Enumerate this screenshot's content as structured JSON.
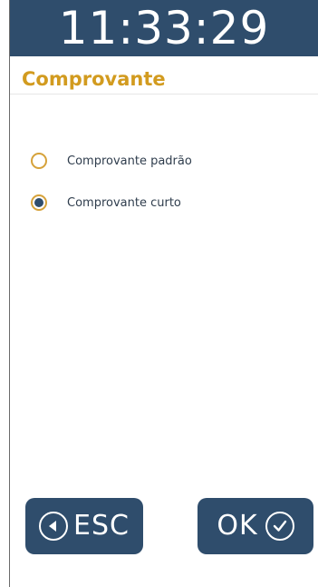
{
  "clock": {
    "time": "11:33:29"
  },
  "screen": {
    "title": "Comprovante"
  },
  "options": [
    {
      "label": "Comprovante padrão",
      "selected": false
    },
    {
      "label": "Comprovante curto",
      "selected": true
    }
  ],
  "buttons": {
    "esc_label": "ESC",
    "esc_icon": "back-arrow-icon",
    "ok_label": "OK",
    "ok_icon": "checkmark-icon"
  },
  "colors": {
    "header_bg": "#2f4d6c",
    "title": "#d29b1f",
    "radio_border": "#d6a23a",
    "button_bg": "#2f4d6c"
  }
}
